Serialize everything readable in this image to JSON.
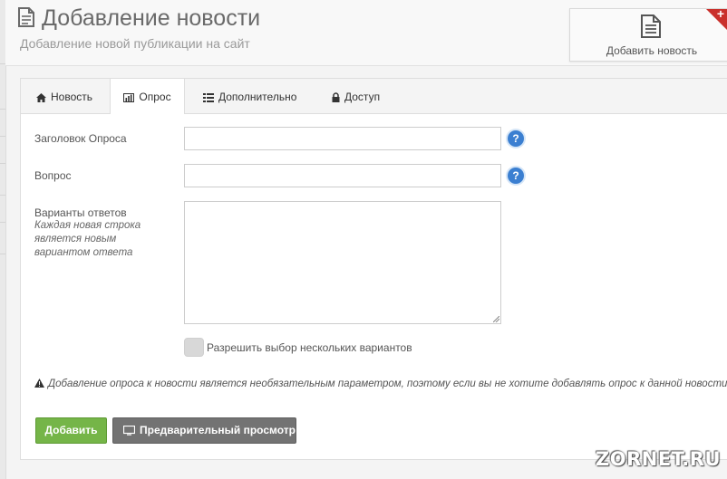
{
  "header": {
    "title": "Добавление новости",
    "subtitle": "Добавление новой публикации на сайт",
    "add_button_label": "Добавить новость",
    "add_button_badge": "+"
  },
  "tabs": [
    {
      "label": "Новость",
      "icon": "home-icon",
      "active": false
    },
    {
      "label": "Опрос",
      "icon": "bar-chart-icon",
      "active": true
    },
    {
      "label": "Дополнительно",
      "icon": "list-icon",
      "active": false
    },
    {
      "label": "Доступ",
      "icon": "lock-icon",
      "active": false
    }
  ],
  "form": {
    "poll_title_label": "Заголовок Опроса",
    "poll_title_value": "",
    "question_label": "Вопрос",
    "question_value": "",
    "answers_label": "Варианты ответов",
    "answers_hint": "Каждая новая строка является новым вариантом ответа",
    "answers_value": "",
    "help_glyph": "?",
    "multiple_choice_label": "Разрешить выбор нескольких вариантов",
    "multiple_choice_enabled": false
  },
  "note": {
    "text": "Добавление опроса к новости является необязательным параметром, поэтому если вы не хотите добавлять опрос к данной новости, то пр"
  },
  "buttons": {
    "add_label": "Добавить",
    "preview_label": "Предварительный просмотр"
  },
  "watermark": "ZORNET.RU",
  "colors": {
    "add_button": "#75b548",
    "preview_button": "#737373",
    "help_icon": "#3b7fd1",
    "corner_badge": "#c9302c"
  }
}
